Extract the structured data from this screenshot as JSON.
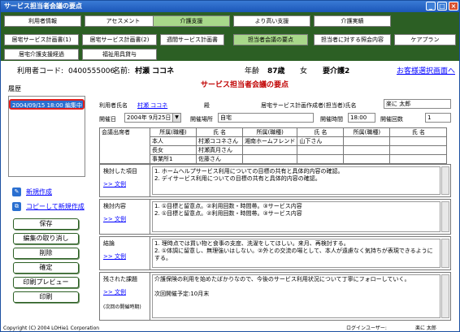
{
  "window": {
    "title": "サービス担当者会議の要点"
  },
  "nav": {
    "row1": [
      "利用者情報",
      "アセスメント",
      "介護支援",
      "より高い支援",
      "介護実績"
    ],
    "row2": [
      "居宅サービス計画書(1)",
      "居宅サービス計画書(2)",
      "週間サービス計画書",
      "担当者会議の要点",
      "担当者に対する照会内容",
      "ケアプラン"
    ],
    "row3": [
      "居宅介護支援経過",
      "福祉用具貸与"
    ]
  },
  "patient": {
    "code_label": "利用者コード:",
    "code": "0400555006",
    "name_label": "名前:",
    "name": "村瀬 ココネ",
    "age_label": "年齢",
    "age": "87歳",
    "sex": "女",
    "care_level": "要介護2",
    "select_link": "お客様選択画面へ"
  },
  "heading": "サービス担当者会議の要点",
  "history": {
    "label": "履歴",
    "items": [
      "2004/09/15 18:00 編集中"
    ]
  },
  "sidebar": {
    "new_link": "新規作成",
    "copy_link": "コピーして新規作成",
    "buttons": [
      "保存",
      "編集の取り消し",
      "削除",
      "確定",
      "印刷プレビュー",
      "印刷"
    ]
  },
  "form": {
    "user_label": "利用者氏名",
    "user_value": "村瀬 ココネ",
    "honorific": "殿",
    "planner_label": "居宅サービス計画作成者(担当者)氏名",
    "planner_value": "楽に 太郎",
    "date_label": "開催日",
    "date_value": "2004年 9月25日",
    "place_label": "開催場所",
    "place_value": "自宅",
    "time_label": "開催時間",
    "time_value": "18:00",
    "count_label": "開催回数",
    "count_value": "1"
  },
  "attendees": {
    "label": "会議出席者",
    "headers": [
      "所属(職種)",
      "氏 名",
      "所属(職種)",
      "氏 名",
      "所属(職種)",
      "氏 名"
    ],
    "rows": [
      [
        "本人",
        "村瀬ココネさん",
        "湘南ホームフレンド",
        "山下さん",
        "",
        ""
      ],
      [
        "長女",
        "村瀬真月さん",
        "",
        "",
        "",
        ""
      ],
      [
        "事業所1",
        "佐藤さん",
        "",
        "",
        "",
        ""
      ]
    ]
  },
  "sections": [
    {
      "title": "検討した項目",
      "link": "文例",
      "text": "1. ホームヘルプサービス利用についての目標の共有と具体的内容の確認。\n2. デイサービス利用についての目標の共有と具体的内容の確認。"
    },
    {
      "title": "検討内容",
      "link": "文例",
      "text": "1. ①目標と留意点。②利用回数・時間帯。③サービス内容\n2. ①目標と留意点。②利用回数・時間帯。③サービス内容"
    },
    {
      "title": "結論",
      "link": "文例",
      "text": "1. 理時点では買い物と食事の支度、洗濯をしてほしい。来月、再検討する。\n2. ①体調に留意し、無理強いはしない。②外との交流の場として、本人が遠慮なく気持ちが表現できるようにする。"
    },
    {
      "title": "残された課題",
      "link": "文例",
      "sub": "(次回の開催時期)",
      "text": "介護保険の利用を始めたばかりなので、今後のサービス利用状況について丁寧にフォローしていく。\n\n次回開催予定:10月末"
    }
  ],
  "footer": {
    "copyright": "Copyright (C) 2004 LOHie1 Corporation",
    "login_label": "ログインユーザー:",
    "login_user": "楽に 太郎"
  },
  "colors": {
    "nav_bg": "#2c5f24",
    "active_tab": "#a8d88a",
    "title_bar": "#1b56b8",
    "heading_red": "#c00000"
  }
}
